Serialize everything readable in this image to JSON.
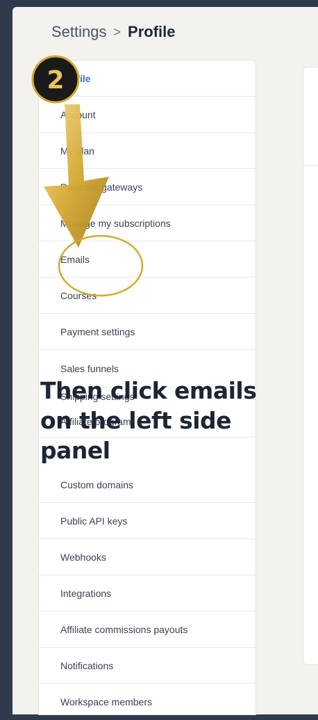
{
  "breadcrumb": {
    "parent": "Settings",
    "separator": ">",
    "current": "Profile"
  },
  "sidebar": {
    "items": [
      {
        "label": "Profile",
        "active": true
      },
      {
        "label": "Account"
      },
      {
        "label": "My plan"
      },
      {
        "label": "Payment gateways"
      },
      {
        "label": "Manage my subscriptions"
      },
      {
        "label": "Emails"
      },
      {
        "label": "Courses"
      },
      {
        "label": "Payment settings"
      },
      {
        "label": "Sales funnels"
      },
      {
        "label": "Shipping settings"
      },
      {
        "label": "Affiliate program"
      },
      {
        "label": "Custom domains"
      },
      {
        "label": "Public API keys"
      },
      {
        "label": "Webhooks"
      },
      {
        "label": "Integrations"
      },
      {
        "label": "Affiliate commissions payouts"
      },
      {
        "label": "Notifications"
      },
      {
        "label": "Workspace members"
      }
    ]
  },
  "overlay": {
    "step_number": "2",
    "instruction": "Then click emails on the left side panel",
    "accent": "#d4a832"
  },
  "colors": {
    "background": "#2f3a4d",
    "active": "#3a6fd8"
  }
}
